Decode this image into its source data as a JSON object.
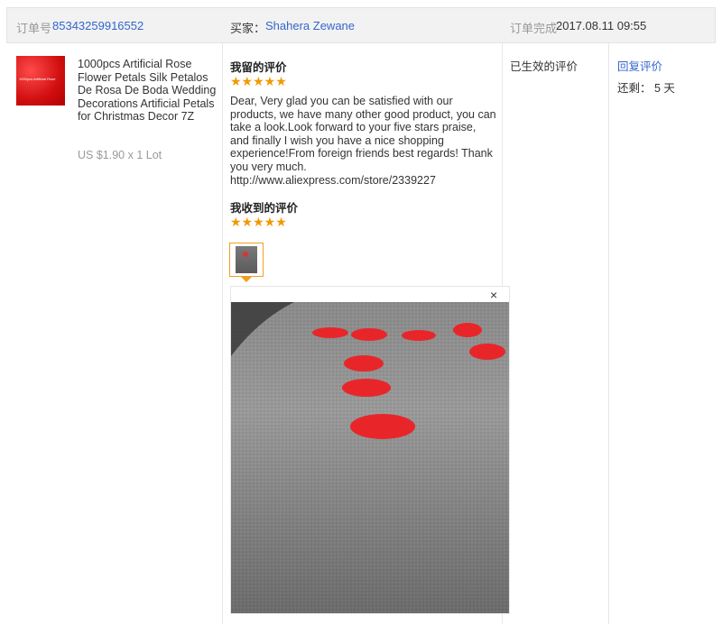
{
  "header": {
    "order_label": "订单号",
    "order_number": "85343259916552",
    "buyer_label": "买家：",
    "buyer_name": "Shahera Zewane",
    "completed_label": "订单完成",
    "completed_time": "2017.08.11 09:55"
  },
  "product": {
    "thumb_caption": "1000pcs Artificial Rose",
    "title": "1000pcs Artificial Rose Flower Petals Silk Petalos De Rosa De Boda Wedding Decorations Artificial Petals for Christmas Decor 7Z",
    "price": "US $1.90 x 1 Lot"
  },
  "my_review": {
    "label": "我留的评价",
    "stars": "★★★★★",
    "rating": 5,
    "text": "Dear, Very glad you can be satisfied with our products, we have many other good product, you can take a look.Look forward to your five stars praise, and finally I wish you have a nice shopping experience!From foreign friends best regards! Thank you very much. http://www.aliexpress.com/store/2339227"
  },
  "received_review": {
    "label": "我收到的评价",
    "stars": "★★★★★",
    "rating": 5,
    "photo_close": "×"
  },
  "status": {
    "effective": "已生效的评价",
    "reply_link": "回复评价",
    "remaining": "还剩： 5 天"
  },
  "colors": {
    "link": "#3366cc",
    "star": "#f39800",
    "header_bg": "#f2f2f2",
    "petal": "#e8262a"
  }
}
